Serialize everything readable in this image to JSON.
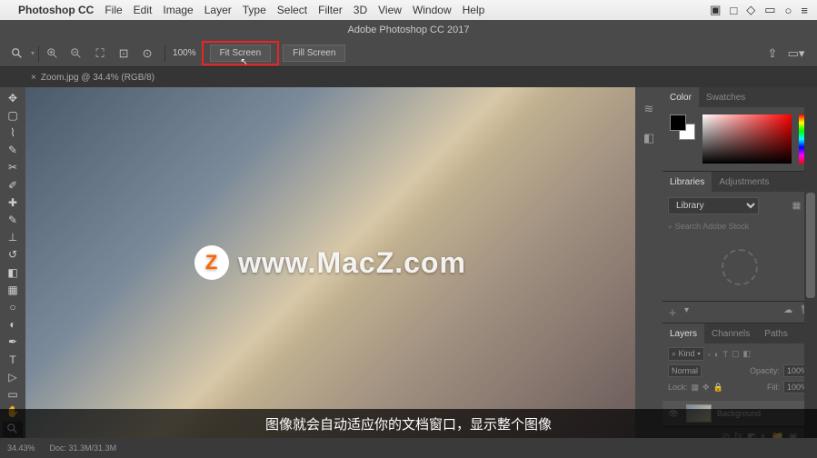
{
  "macos": {
    "app_name": "Photoshop CC",
    "menus": [
      "File",
      "Edit",
      "Image",
      "Layer",
      "Type",
      "Select",
      "Filter",
      "3D",
      "View",
      "Window",
      "Help"
    ]
  },
  "titlebar": "Adobe Photoshop CC 2017",
  "options": {
    "zoom_pct": "100%",
    "fit_screen": "Fit Screen",
    "fill_screen": "Fill Screen"
  },
  "doc_tab": {
    "label": "Zoom.jpg @ 34.4% (RGB/8)"
  },
  "watermark": "www.MacZ.com",
  "panels": {
    "color": {
      "tabs": [
        "Color",
        "Swatches"
      ]
    },
    "libraries": {
      "tabs": [
        "Libraries",
        "Adjustments"
      ],
      "library_label": "Library",
      "search_placeholder": "Search Adobe Stock"
    },
    "layers": {
      "tabs": [
        "Layers",
        "Channels",
        "Paths"
      ],
      "kind": "Kind",
      "blend": "Normal",
      "opacity_label": "Opacity:",
      "opacity_val": "100%",
      "lock_label": "Lock:",
      "fill_label": "Fill:",
      "fill_val": "100%",
      "bg_layer": "Background"
    }
  },
  "subtitle": "图像就会自动适应你的文档窗口，显示整个图像",
  "status": {
    "zoom": "34.43%",
    "doc": "Doc: 31.3M/31.3M"
  }
}
